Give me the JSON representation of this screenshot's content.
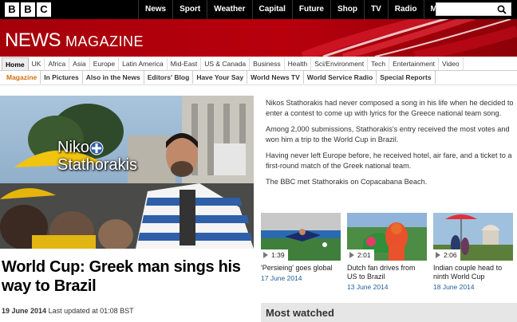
{
  "logo": {
    "letters": [
      "B",
      "B",
      "C"
    ]
  },
  "topnav": {
    "items": [
      "News",
      "Sport",
      "Weather",
      "Capital",
      "Future",
      "Shop",
      "TV",
      "Radio",
      "More…"
    ]
  },
  "search": {
    "placeholder": "",
    "icon": "search-icon"
  },
  "masthead": {
    "news": "NEWS",
    "magazine": "MAGAZINE"
  },
  "section_nav": {
    "items": [
      "Home",
      "UK",
      "Africa",
      "Asia",
      "Europe",
      "Latin America",
      "Mid-East",
      "US & Canada",
      "Business",
      "Health",
      "Sci/Environment",
      "Tech",
      "Entertainment",
      "Video"
    ],
    "active": "Home"
  },
  "sub_nav": {
    "items": [
      "Magazine",
      "In Pictures",
      "Also in the News",
      "Editors' Blog",
      "Have Your Say",
      "World News TV",
      "World Service Radio",
      "Special Reports"
    ],
    "active": "Magazine"
  },
  "video": {
    "caption": [
      "Nikos",
      "Stathorakis"
    ]
  },
  "article": {
    "headline": "World Cup: Greek man sings his way to Brazil",
    "date": "19 June 2014",
    "updated": "Last updated at 01:08 BST",
    "paragraphs": [
      "Nikos Stathorakis had never composed a song in his life when he decided to enter a contest to come up with lyrics for the Greece national team song.",
      "Among 2,000 submissions, Stathorakis's entry received the most votes and won him a trip to the World Cup in Brazil.",
      "Having never left Europe before, he received hotel, air fare, and a ticket to a first-round match of the Greek national team.",
      "The BBC met Stathorakis on Copacabana Beach."
    ]
  },
  "related_videos": [
    {
      "duration": "1:39",
      "title": "'Persieing' goes global",
      "date": "17 June 2014"
    },
    {
      "duration": "2:01",
      "title": "Dutch fan drives from US to Brazil",
      "date": "13 June 2014"
    },
    {
      "duration": "2:06",
      "title": "Indian couple head to ninth World Cup",
      "date": "18 June 2014"
    }
  ],
  "most_watched": {
    "label": "Most watched"
  },
  "colors": {
    "masthead": "#a5000a",
    "accent_orange": "#d1700e",
    "date_blue": "#1f5e9c"
  }
}
